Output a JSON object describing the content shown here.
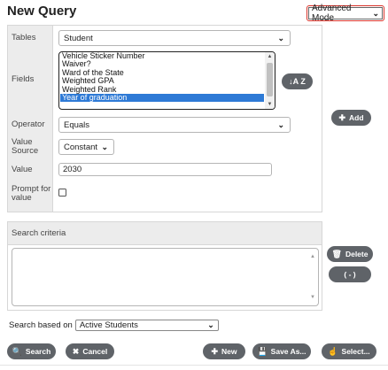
{
  "header": {
    "title": "New Query",
    "mode_value": "Advanced Mode"
  },
  "form": {
    "labels": {
      "tables": "Tables",
      "fields": "Fields",
      "operator": "Operator",
      "value_source": "Value Source",
      "value": "Value",
      "prompt": "Prompt for value"
    },
    "tables_value": "Student",
    "fields_options": [
      "Vehicle Sticker Number",
      "Waiver?",
      "Ward of the State",
      "Weighted GPA",
      "Weighted Rank",
      "Year of graduation"
    ],
    "fields_selected": "Year of graduation",
    "sort_label": "↓A Z",
    "operator_value": "Equals",
    "value_source_value": "Constant",
    "value_value": "2030",
    "prompt_checked": false
  },
  "actions": {
    "add_label": "Add",
    "delete_label": "Delete",
    "paren_label": "( - )"
  },
  "criteria": {
    "heading": "Search criteria"
  },
  "based_on": {
    "label": "Search based on",
    "value": "Active Students"
  },
  "toolbar": {
    "search_label": "Search",
    "cancel_label": "Cancel",
    "new_label": "New",
    "save_as_label": "Save As...",
    "select_label": "Select..."
  },
  "colors": {
    "button_bg": "#5f6368",
    "highlight": "#2e7ad6",
    "mode_border": "#d9342b"
  }
}
